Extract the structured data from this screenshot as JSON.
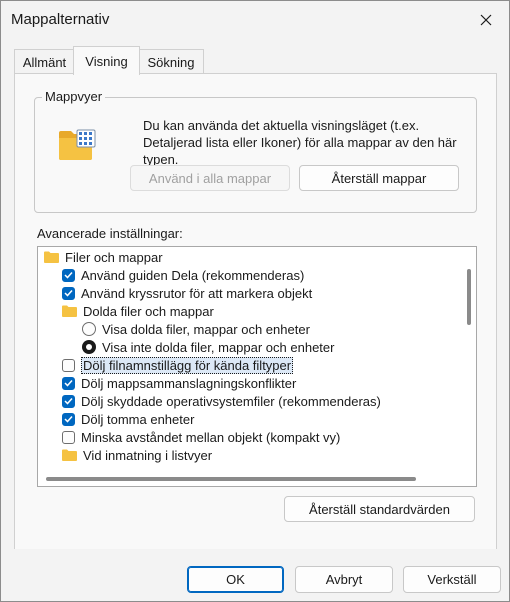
{
  "window": {
    "title": "Mappalternativ"
  },
  "tabs": [
    {
      "label": "Allmänt"
    },
    {
      "label": "Visning"
    },
    {
      "label": "Sökning"
    }
  ],
  "folder_views": {
    "legend": "Mappvyer",
    "description": "Du kan använda det aktuella visningsläget (t.ex. Detaljerad lista eller Ikoner) för alla mappar av den här typen.",
    "apply_button": "Använd i alla mappar",
    "reset_button": "Återställ mappar"
  },
  "advanced": {
    "label": "Avancerade inställningar:",
    "items": [
      {
        "type": "folder",
        "label": "Filer och mappar"
      },
      {
        "type": "checkbox",
        "checked": true,
        "label": "Använd guiden Dela (rekommenderas)"
      },
      {
        "type": "checkbox",
        "checked": true,
        "label": "Använd kryssrutor för att markera objekt"
      },
      {
        "type": "folder",
        "label": "Dolda filer och mappar"
      },
      {
        "type": "radio",
        "checked": false,
        "label": "Visa dolda filer, mappar och enheter"
      },
      {
        "type": "radio",
        "checked": true,
        "label": "Visa inte dolda filer, mappar och enheter"
      },
      {
        "type": "checkbox",
        "checked": false,
        "label": "Dölj filnamnstillägg för kända filtyper"
      },
      {
        "type": "checkbox",
        "checked": true,
        "label": "Dölj mappsammanslagningskonflikter"
      },
      {
        "type": "checkbox",
        "checked": true,
        "label": "Dölj skyddade operativsystemfiler (rekommenderas)"
      },
      {
        "type": "checkbox",
        "checked": true,
        "label": "Dölj tomma enheter"
      },
      {
        "type": "checkbox",
        "checked": false,
        "label": "Minska avståndet mellan objekt (kompakt vy)"
      },
      {
        "type": "folder",
        "label": "Vid inmatning i listvyer"
      }
    ],
    "restore_defaults_button": "Återställ standardvärden"
  },
  "footer": {
    "ok": "OK",
    "cancel": "Avbryt",
    "apply": "Verkställ"
  },
  "colors": {
    "accent": "#0067c0",
    "folder": "#f5c242",
    "selection": "#dce8f6"
  },
  "icons": {
    "close": "close-icon",
    "folder": "folder-icon",
    "checkmark": "checkmark-icon"
  }
}
